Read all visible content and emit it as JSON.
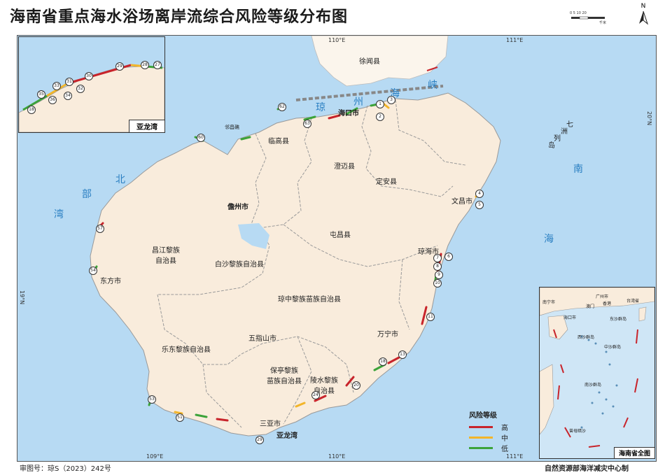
{
  "title": "海南省重点海水浴场离岸流综合风险等级分布图",
  "scale": {
    "labels": "0  5  10  20",
    "unit": "千米"
  },
  "north": "N",
  "grid": {
    "lon": [
      "109°E",
      "110°E",
      "111°E"
    ],
    "lat": [
      "20°N",
      "19°N"
    ]
  },
  "cities": [
    {
      "name": "徐闻县"
    },
    {
      "name": "海口市"
    },
    {
      "name": "临高县"
    },
    {
      "name": "澄迈县"
    },
    {
      "name": "定安县"
    },
    {
      "name": "文昌市"
    },
    {
      "name": "儋州市"
    },
    {
      "name": "屯昌县"
    },
    {
      "name": "琼海市"
    },
    {
      "name": "昌江黎族\n自治县"
    },
    {
      "name": "白沙黎族自治县"
    },
    {
      "name": "东方市"
    },
    {
      "name": "琼中黎族苗族自治县"
    },
    {
      "name": "万宁市"
    },
    {
      "name": "五指山市"
    },
    {
      "name": "乐东黎族自治县"
    },
    {
      "name": "保亭黎族\n苗族自治县"
    },
    {
      "name": "陵水黎族\n自治县"
    },
    {
      "name": "三亚市"
    },
    {
      "name": "邻昌礁"
    }
  ],
  "seas": [
    "琼",
    "州",
    "海",
    "峡",
    "北",
    "部",
    "湾",
    "南",
    "海",
    "七",
    "洲",
    "列",
    "岛"
  ],
  "inset_bay": {
    "label": "亚龙湾",
    "points": [
      "18",
      "35",
      "36",
      "34",
      "33",
      "32",
      "31",
      "30",
      "29",
      "28",
      "27"
    ]
  },
  "inset_china": {
    "label": "海南省全图",
    "places": [
      "南宁市",
      "广州市",
      "香港",
      "澳门",
      "海口市",
      "台湾省",
      "东沙群岛",
      "西沙群岛",
      "中沙群岛",
      "南沙群岛",
      "曾母暗沙"
    ]
  },
  "callout": "亚龙湾",
  "legend": {
    "title": "风险等级",
    "items": [
      {
        "label": "高",
        "color": "#c8242b"
      },
      {
        "label": "中",
        "color": "#f2b52a"
      },
      {
        "label": "低",
        "color": "#3ca33a"
      }
    ]
  },
  "footer": {
    "left": "审图号：琼S（2023）242号",
    "right": "自然资源部海洋减灾中心制"
  },
  "colors": {
    "sea": "#b7daf3",
    "land": "#f9ecdc",
    "mainland": "#fbf5ec",
    "boundary": "#9a9a9a"
  }
}
